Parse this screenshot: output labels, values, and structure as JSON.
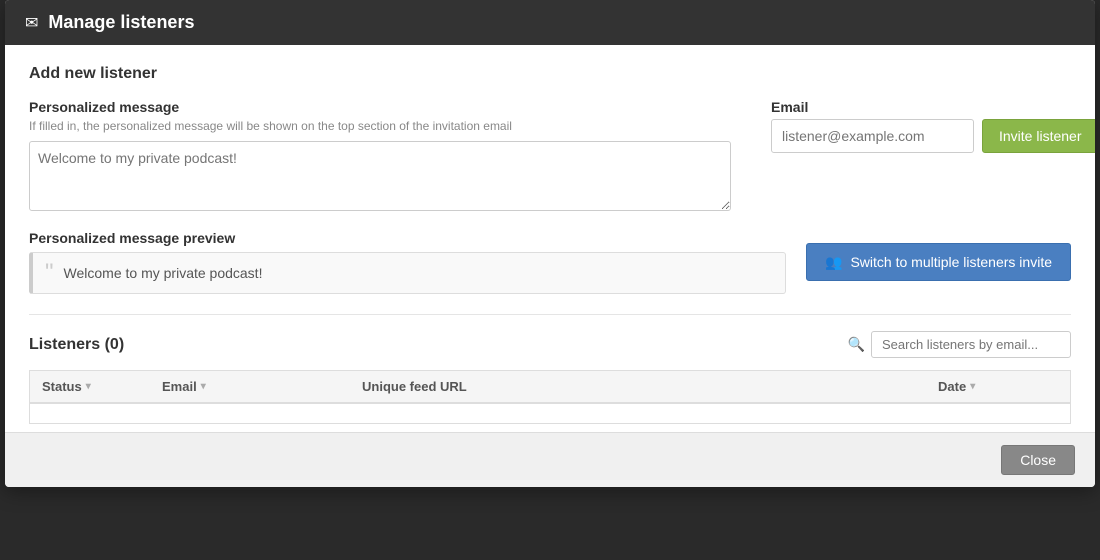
{
  "modal": {
    "header": {
      "icon": "✉",
      "title": "Manage listeners"
    },
    "add_section": {
      "title": "Add new listener",
      "personalized_message": {
        "label": "Personalized message",
        "hint": "If filled in, the personalized message will be shown on the top section of the invitation email",
        "placeholder": "Welcome to my private podcast!"
      },
      "email": {
        "label": "Email",
        "placeholder": "listener@example.com"
      },
      "invite_button": "Invite listener",
      "preview_label": "Personalized message preview",
      "preview_text": "Welcome to my private podcast!",
      "switch_button": "Switch to multiple listeners invite",
      "switch_icon": "👥"
    },
    "listeners_section": {
      "title": "Listeners (0)",
      "search_placeholder": "Search listeners by email...",
      "table": {
        "columns": [
          {
            "label": "Status",
            "key": "status"
          },
          {
            "label": "Email",
            "key": "email"
          },
          {
            "label": "Unique feed URL",
            "key": "url"
          },
          {
            "label": "Date",
            "key": "date"
          }
        ]
      }
    },
    "footer": {
      "close_button": "Close"
    }
  }
}
